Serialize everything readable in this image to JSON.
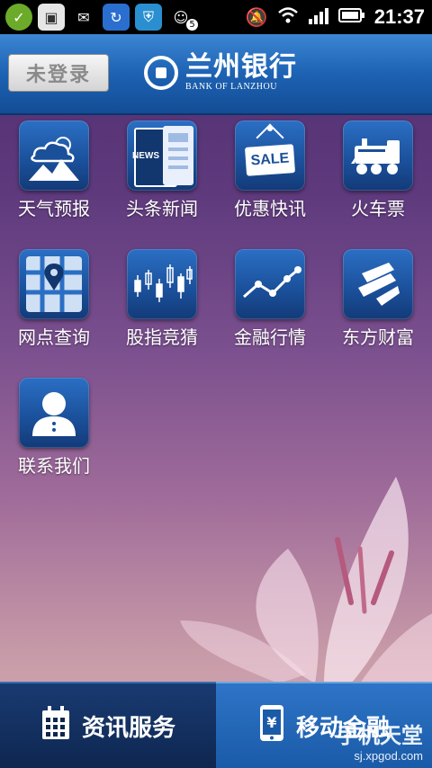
{
  "status_bar": {
    "time": "21:37",
    "notification_count": "5"
  },
  "header": {
    "login_button": "未登录",
    "brand_cn": "兰州银行",
    "brand_en": "BANK OF LANZHOU"
  },
  "tiles": [
    {
      "label": "天气预报",
      "icon": "weather-icon"
    },
    {
      "label": "头条新闻",
      "icon": "news-icon",
      "icon_text": "NEWS"
    },
    {
      "label": "优惠快讯",
      "icon": "sale-icon",
      "icon_text": "SALE"
    },
    {
      "label": "火车票",
      "icon": "train-icon"
    },
    {
      "label": "网点查询",
      "icon": "map-pin-icon"
    },
    {
      "label": "股指竞猜",
      "icon": "candlestick-icon"
    },
    {
      "label": "金融行情",
      "icon": "line-chart-icon"
    },
    {
      "label": "东方财富",
      "icon": "eastmoney-icon"
    },
    {
      "label": "联系我们",
      "icon": "contact-icon"
    }
  ],
  "tabs": [
    {
      "label": "资讯服务",
      "icon": "calendar-icon",
      "active": true
    },
    {
      "label": "移动金融",
      "icon": "mobile-yen-icon",
      "active": false
    }
  ],
  "watermark": {
    "title": "手机天堂",
    "url": "sj.xpgod.com"
  },
  "colors": {
    "header_blue": "#1d62b3",
    "tile_blue": "#1a4f99",
    "tab_active": "#0e2750"
  }
}
